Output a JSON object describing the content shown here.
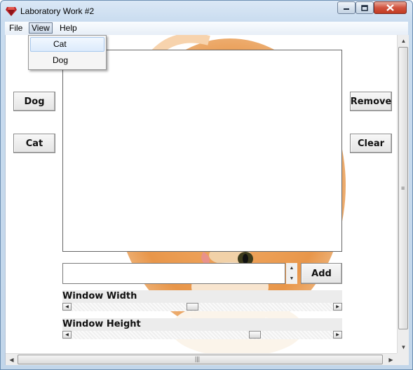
{
  "window": {
    "title": "Laboratory Work #2",
    "icons": {
      "app": "app-gem-icon",
      "minimize": "minimize-icon",
      "maximize": "maximize-icon",
      "close": "close-icon"
    }
  },
  "menu": {
    "items": [
      {
        "label": "File",
        "active": false
      },
      {
        "label": "View",
        "active": true
      },
      {
        "label": "Help",
        "active": false
      }
    ],
    "view_dropdown": [
      {
        "label": "Cat",
        "highlighted": true
      },
      {
        "label": "Dog",
        "highlighted": false
      }
    ]
  },
  "buttons": {
    "dog": "Dog",
    "cat": "Cat",
    "remove": "Remove",
    "clear": "Clear",
    "add": "Add"
  },
  "input": {
    "value": "",
    "placeholder": ""
  },
  "sliders": {
    "width_label": "Window Width",
    "height_label": "Window Height",
    "width_value_fraction": 0.46,
    "height_value_fraction": 0.71
  },
  "list": {
    "items": []
  },
  "colors": {
    "titlebar": "#c9dcef",
    "close_button": "#c23b22",
    "menu_highlight": "#dcebfc",
    "background_cat": "#e8964a"
  }
}
